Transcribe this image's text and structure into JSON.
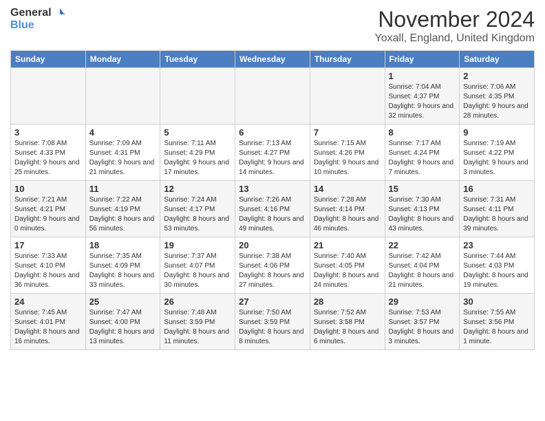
{
  "logo": {
    "general": "General",
    "blue": "Blue"
  },
  "header": {
    "month": "November 2024",
    "location": "Yoxall, England, United Kingdom"
  },
  "days_of_week": [
    "Sunday",
    "Monday",
    "Tuesday",
    "Wednesday",
    "Thursday",
    "Friday",
    "Saturday"
  ],
  "weeks": [
    [
      {
        "day": "",
        "info": ""
      },
      {
        "day": "",
        "info": ""
      },
      {
        "day": "",
        "info": ""
      },
      {
        "day": "",
        "info": ""
      },
      {
        "day": "",
        "info": ""
      },
      {
        "day": "1",
        "info": "Sunrise: 7:04 AM\nSunset: 4:37 PM\nDaylight: 9 hours and 32 minutes."
      },
      {
        "day": "2",
        "info": "Sunrise: 7:06 AM\nSunset: 4:35 PM\nDaylight: 9 hours and 28 minutes."
      }
    ],
    [
      {
        "day": "3",
        "info": "Sunrise: 7:08 AM\nSunset: 4:33 PM\nDaylight: 9 hours and 25 minutes."
      },
      {
        "day": "4",
        "info": "Sunrise: 7:09 AM\nSunset: 4:31 PM\nDaylight: 9 hours and 21 minutes."
      },
      {
        "day": "5",
        "info": "Sunrise: 7:11 AM\nSunset: 4:29 PM\nDaylight: 9 hours and 17 minutes."
      },
      {
        "day": "6",
        "info": "Sunrise: 7:13 AM\nSunset: 4:27 PM\nDaylight: 9 hours and 14 minutes."
      },
      {
        "day": "7",
        "info": "Sunrise: 7:15 AM\nSunset: 4:26 PM\nDaylight: 9 hours and 10 minutes."
      },
      {
        "day": "8",
        "info": "Sunrise: 7:17 AM\nSunset: 4:24 PM\nDaylight: 9 hours and 7 minutes."
      },
      {
        "day": "9",
        "info": "Sunrise: 7:19 AM\nSunset: 4:22 PM\nDaylight: 9 hours and 3 minutes."
      }
    ],
    [
      {
        "day": "10",
        "info": "Sunrise: 7:21 AM\nSunset: 4:21 PM\nDaylight: 9 hours and 0 minutes."
      },
      {
        "day": "11",
        "info": "Sunrise: 7:22 AM\nSunset: 4:19 PM\nDaylight: 8 hours and 56 minutes."
      },
      {
        "day": "12",
        "info": "Sunrise: 7:24 AM\nSunset: 4:17 PM\nDaylight: 8 hours and 53 minutes."
      },
      {
        "day": "13",
        "info": "Sunrise: 7:26 AM\nSunset: 4:16 PM\nDaylight: 8 hours and 49 minutes."
      },
      {
        "day": "14",
        "info": "Sunrise: 7:28 AM\nSunset: 4:14 PM\nDaylight: 8 hours and 46 minutes."
      },
      {
        "day": "15",
        "info": "Sunrise: 7:30 AM\nSunset: 4:13 PM\nDaylight: 8 hours and 43 minutes."
      },
      {
        "day": "16",
        "info": "Sunrise: 7:31 AM\nSunset: 4:11 PM\nDaylight: 8 hours and 39 minutes."
      }
    ],
    [
      {
        "day": "17",
        "info": "Sunrise: 7:33 AM\nSunset: 4:10 PM\nDaylight: 8 hours and 36 minutes."
      },
      {
        "day": "18",
        "info": "Sunrise: 7:35 AM\nSunset: 4:09 PM\nDaylight: 8 hours and 33 minutes."
      },
      {
        "day": "19",
        "info": "Sunrise: 7:37 AM\nSunset: 4:07 PM\nDaylight: 8 hours and 30 minutes."
      },
      {
        "day": "20",
        "info": "Sunrise: 7:38 AM\nSunset: 4:06 PM\nDaylight: 8 hours and 27 minutes."
      },
      {
        "day": "21",
        "info": "Sunrise: 7:40 AM\nSunset: 4:05 PM\nDaylight: 8 hours and 24 minutes."
      },
      {
        "day": "22",
        "info": "Sunrise: 7:42 AM\nSunset: 4:04 PM\nDaylight: 8 hours and 21 minutes."
      },
      {
        "day": "23",
        "info": "Sunrise: 7:44 AM\nSunset: 4:03 PM\nDaylight: 8 hours and 19 minutes."
      }
    ],
    [
      {
        "day": "24",
        "info": "Sunrise: 7:45 AM\nSunset: 4:01 PM\nDaylight: 8 hours and 16 minutes."
      },
      {
        "day": "25",
        "info": "Sunrise: 7:47 AM\nSunset: 4:00 PM\nDaylight: 8 hours and 13 minutes."
      },
      {
        "day": "26",
        "info": "Sunrise: 7:48 AM\nSunset: 3:59 PM\nDaylight: 8 hours and 11 minutes."
      },
      {
        "day": "27",
        "info": "Sunrise: 7:50 AM\nSunset: 3:59 PM\nDaylight: 8 hours and 8 minutes."
      },
      {
        "day": "28",
        "info": "Sunrise: 7:52 AM\nSunset: 3:58 PM\nDaylight: 8 hours and 6 minutes."
      },
      {
        "day": "29",
        "info": "Sunrise: 7:53 AM\nSunset: 3:57 PM\nDaylight: 8 hours and 3 minutes."
      },
      {
        "day": "30",
        "info": "Sunrise: 7:55 AM\nSunset: 3:56 PM\nDaylight: 8 hours and 1 minute."
      }
    ]
  ]
}
